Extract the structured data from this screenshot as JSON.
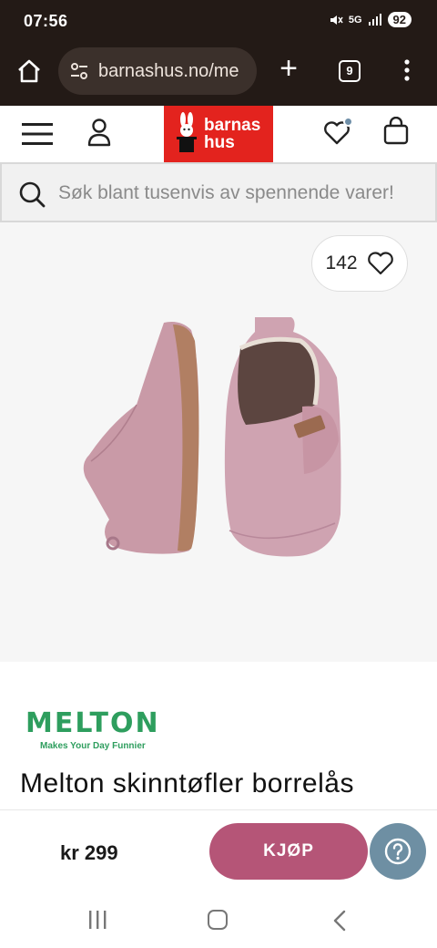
{
  "status_bar": {
    "time": "07:56",
    "network": "5G",
    "battery": "92"
  },
  "browser": {
    "url": "barnashus.no/me",
    "tab_count": "9"
  },
  "site": {
    "logo_text_line1": "barnas",
    "logo_text_line2": "hus",
    "search_placeholder": "Søk blant tusenvis av spennende varer!"
  },
  "product": {
    "like_count": "142",
    "brand_name": "MELTON",
    "brand_slogan": "Makes Your Day Funnier",
    "title": "Melton skinntøfler borrelås",
    "price": "kr 299",
    "buy_label": "KJØP"
  },
  "colors": {
    "brand_red": "#e3231e",
    "buy_button": "#b55577",
    "help_button": "#6e8fa3",
    "melton_green": "#2e9e5e"
  },
  "icons": [
    "home-icon",
    "tune-icon",
    "plus-icon",
    "tabs-icon",
    "more-vert-icon",
    "hamburger-icon",
    "user-icon",
    "heart-icon",
    "cart-icon",
    "search-icon",
    "question-icon"
  ]
}
